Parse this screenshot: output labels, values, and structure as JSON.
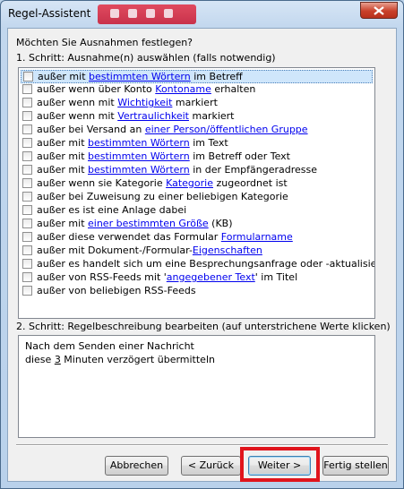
{
  "window": {
    "title": "Regel-Assistent"
  },
  "prompt": "Möchten Sie Ausnahmen festlegen?",
  "step1_label": "1. Schritt: Ausnahme(n) auswählen (falls notwendig)",
  "exceptions": [
    {
      "parts": [
        {
          "t": "außer mit "
        },
        {
          "t": "bestimmten Wörtern",
          "link": true
        },
        {
          "t": " im Betreff"
        }
      ],
      "selected": true
    },
    {
      "parts": [
        {
          "t": "außer wenn über Konto "
        },
        {
          "t": "Kontoname",
          "link": true
        },
        {
          "t": " erhalten"
        }
      ]
    },
    {
      "parts": [
        {
          "t": "außer wenn mit "
        },
        {
          "t": "Wichtigkeit",
          "link": true
        },
        {
          "t": " markiert"
        }
      ]
    },
    {
      "parts": [
        {
          "t": "außer wenn mit "
        },
        {
          "t": "Vertraulichkeit",
          "link": true
        },
        {
          "t": " markiert"
        }
      ]
    },
    {
      "parts": [
        {
          "t": "außer bei Versand an "
        },
        {
          "t": "einer Person/öffentlichen Gruppe",
          "link": true
        }
      ]
    },
    {
      "parts": [
        {
          "t": "außer mit "
        },
        {
          "t": "bestimmten Wörtern",
          "link": true
        },
        {
          "t": " im Text"
        }
      ]
    },
    {
      "parts": [
        {
          "t": "außer mit "
        },
        {
          "t": "bestimmten Wörtern",
          "link": true
        },
        {
          "t": " im Betreff oder Text"
        }
      ]
    },
    {
      "parts": [
        {
          "t": "außer mit "
        },
        {
          "t": "bestimmten Wörtern",
          "link": true
        },
        {
          "t": " in der Empfängeradresse"
        }
      ]
    },
    {
      "parts": [
        {
          "t": "außer wenn sie Kategorie "
        },
        {
          "t": "Kategorie",
          "link": true
        },
        {
          "t": " zugeordnet ist"
        }
      ]
    },
    {
      "parts": [
        {
          "t": "außer bei Zuweisung zu einer beliebigen Kategorie"
        }
      ]
    },
    {
      "parts": [
        {
          "t": "außer es ist eine Anlage dabei"
        }
      ]
    },
    {
      "parts": [
        {
          "t": "außer mit "
        },
        {
          "t": "einer bestimmten Größe",
          "link": true
        },
        {
          "t": " (KB)"
        }
      ]
    },
    {
      "parts": [
        {
          "t": "außer diese verwendet das Formular "
        },
        {
          "t": "Formularname",
          "link": true
        }
      ]
    },
    {
      "parts": [
        {
          "t": "außer mit Dokument-/Formular-"
        },
        {
          "t": "Eigenschaften",
          "link": true
        }
      ]
    },
    {
      "parts": [
        {
          "t": "außer es handelt sich um eine Besprechungsanfrage oder -aktualisierung"
        }
      ]
    },
    {
      "parts": [
        {
          "t": "außer von RSS-Feeds mit '"
        },
        {
          "t": "angegebener Text",
          "link": true
        },
        {
          "t": "' im Titel"
        }
      ]
    },
    {
      "parts": [
        {
          "t": "außer von beliebigen RSS-Feeds"
        }
      ]
    }
  ],
  "step2_label": "2. Schritt: Regelbeschreibung bearbeiten (auf unterstrichene Werte klicken)",
  "description": {
    "line1": "Nach dem Senden einer Nachricht",
    "line2_pre": "diese ",
    "line2_link": "3",
    "line2_post": " Minuten verzögert übermitteln"
  },
  "buttons": {
    "cancel": "Abbrechen",
    "back": "< Zurück",
    "next": "Weiter >",
    "finish": "Fertig stellen"
  }
}
